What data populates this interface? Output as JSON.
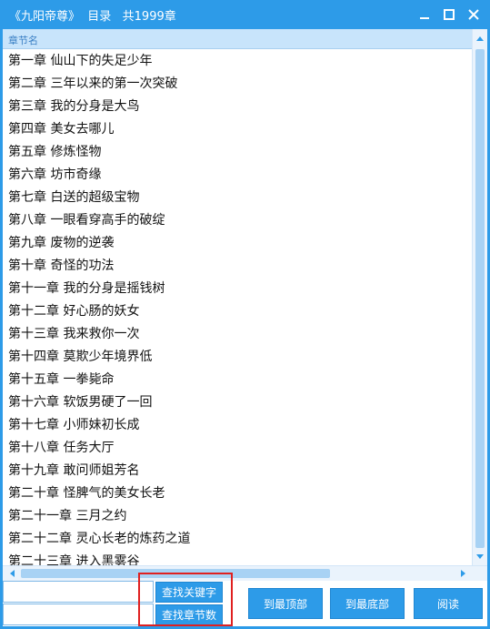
{
  "window": {
    "title": "《九阳帝尊》  目录   共1999章"
  },
  "list": {
    "header": "章节名",
    "rows": [
      "第一章 仙山下的失足少年",
      "第二章 三年以来的第一次突破",
      "第三章 我的分身是大鸟",
      "第四章 美女去哪儿",
      "第五章 修炼怪物",
      "第六章 坊市奇缘",
      "第七章 白送的超级宝物",
      "第八章 一眼看穿高手的破绽",
      "第九章 废物的逆袭",
      "第十章 奇怪的功法",
      "第十一章 我的分身是摇钱树",
      "第十二章 好心肠的妖女",
      "第十三章 我来救你一次",
      "第十四章 莫欺少年境界低",
      "第十五章 一拳毙命",
      "第十六章 软饭男硬了一回",
      "第十七章 小师妹初长成",
      "第十八章 任务大厅",
      "第十九章 敢问师姐芳名",
      "第二十章 怪脾气的美女长老",
      "第二十一章 三月之约",
      "第二十二章 灵心长老的炼药之道",
      "第二十三章 进入黑雾谷"
    ]
  },
  "controls": {
    "keyword_value": "",
    "chapter_value": "",
    "search_keyword_label": "查找关键字",
    "search_chapter_label": "查找章节数",
    "to_top_label": "到最顶部",
    "to_bottom_label": "到最底部",
    "read_label": "阅读"
  },
  "colors": {
    "accent": "#2d9be8",
    "header_bg": "#c8e4fb",
    "highlight": "#e02020"
  }
}
